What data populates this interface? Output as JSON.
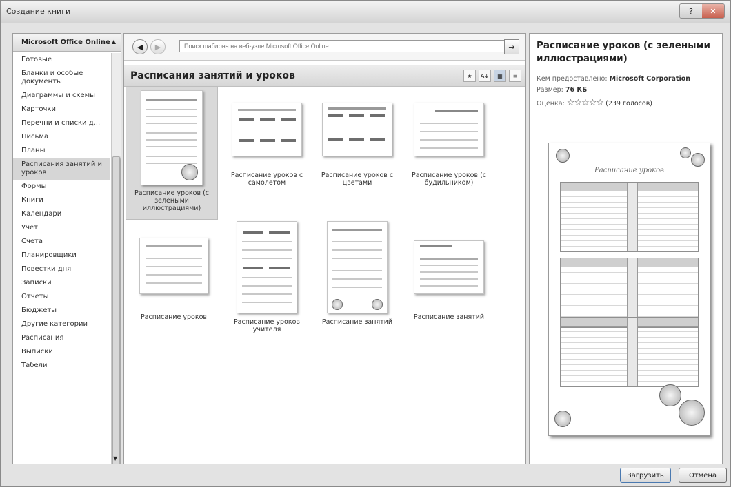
{
  "window": {
    "title": "Создание книги",
    "controls": [
      "?",
      "✕"
    ]
  },
  "sidebar": {
    "header": "Microsoft Office Online",
    "items": [
      {
        "label": "Готовые"
      },
      {
        "label": "Бланки и особые документы"
      },
      {
        "label": "Диаграммы и схемы"
      },
      {
        "label": "Карточки"
      },
      {
        "label": "Перечни и списки д..."
      },
      {
        "label": "Письма"
      },
      {
        "label": "Планы"
      },
      {
        "label": "Расписания занятий и уроков",
        "selected": true
      },
      {
        "label": "Формы"
      },
      {
        "label": "Книги"
      },
      {
        "label": "Календари"
      },
      {
        "label": "Учет"
      },
      {
        "label": "Счета"
      },
      {
        "label": "Планировщики"
      },
      {
        "label": "Повестки дня"
      },
      {
        "label": "Записки"
      },
      {
        "label": "Отчеты"
      },
      {
        "label": "Бюджеты"
      },
      {
        "label": "Другие категории"
      },
      {
        "label": "Расписания"
      },
      {
        "label": "Выписки"
      },
      {
        "label": "Табели"
      }
    ]
  },
  "search": {
    "placeholder": "Поиск шаблона на веб-узле Microsoft Office Online"
  },
  "section": {
    "title": "Расписания занятий и уроков"
  },
  "templates": [
    {
      "label": "Расписание уроков (с зелеными иллюстрациями)",
      "selected": true
    },
    {
      "label": "Расписание уроков с самолетом"
    },
    {
      "label": "Расписание уроков с цветами"
    },
    {
      "label": "Расписание уроков (с будильником)"
    },
    {
      "label": "Расписание уроков"
    },
    {
      "label": "Расписание уроков учителя"
    },
    {
      "label": "Расписание занятий"
    },
    {
      "label": "Расписание занятий"
    }
  ],
  "details": {
    "title": "Расписание уроков (с зелеными иллюстрациями)",
    "provider_label": "Кем предоставлено:",
    "provider": "Microsoft Corporation",
    "size_label": "Размер:",
    "size": "76 КБ",
    "rating_label": "Оценка:",
    "rating_stars": "☆☆☆☆☆",
    "votes": "(239 голосов)",
    "preview_title": "Расписание уроков"
  },
  "buttons": {
    "download": "Загрузить",
    "cancel": "Отмена"
  }
}
